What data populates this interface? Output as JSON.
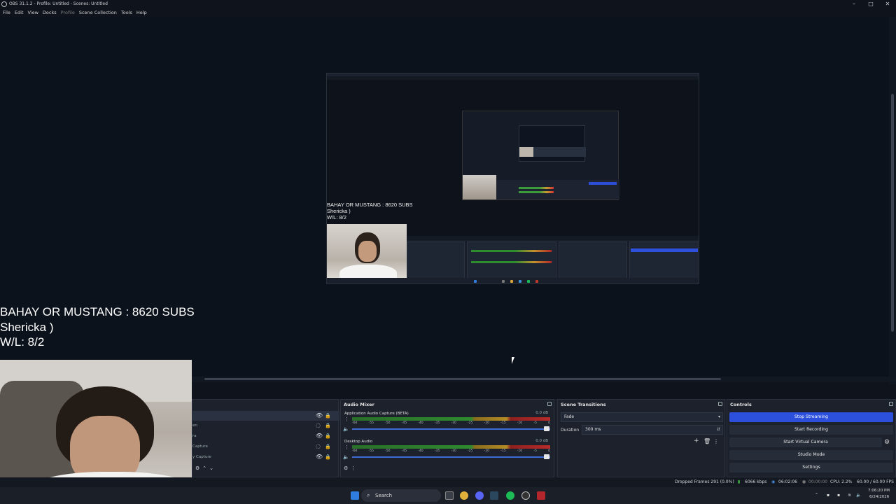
{
  "window": {
    "title": "OBS 31.1.2 - Profile: Untitled - Scenes: Untitled",
    "minimize": "–",
    "maximize": "□",
    "close": "✕"
  },
  "menu": {
    "items": [
      "File",
      "Edit",
      "View",
      "Docks",
      "Profile",
      "Scene Collection",
      "Tools",
      "Help"
    ]
  },
  "overlay": {
    "line1": "BAHAY OR MUSTANG : 8620 SUBS",
    "line2": "Shericka )",
    "line3": "W/L: 8/2"
  },
  "nested": {
    "line1": "BAHAY OR MUSTANG : 8620 SUBS",
    "line2": "Shericka )",
    "line3": "W/L: 8/2"
  },
  "sources": {
    "rows": [
      {
        "label": ""
      },
      {
        "label": "en"
      },
      {
        "label": "ra"
      },
      {
        "label": "Capture"
      },
      {
        "label": "y Capture"
      }
    ]
  },
  "audio_mixer": {
    "title": "Audio Mixer",
    "channels": [
      {
        "name": "Application Audio Capture (BETA)",
        "db": "0.0 dB"
      },
      {
        "name": "Desktop Audio",
        "db": "0.0 dB"
      }
    ],
    "ticks": [
      "-60",
      "-55",
      "-50",
      "-45",
      "-40",
      "-35",
      "-30",
      "-25",
      "-20",
      "-15",
      "-10",
      "-5",
      "0"
    ]
  },
  "scene_transitions": {
    "title": "Scene Transitions",
    "transition": "Fade",
    "duration_label": "Duration",
    "duration_value": "300 ms"
  },
  "controls": {
    "title": "Controls",
    "stop_streaming": "Stop Streaming",
    "start_recording": "Start Recording",
    "start_virtual_camera": "Start Virtual Camera",
    "studio_mode": "Studio Mode",
    "settings": "Settings"
  },
  "status": {
    "dropped": "Dropped Frames 291 (0.0%)",
    "kbps": "6066 kbps",
    "stream_time": "06:02:06",
    "rec_time": "00:00:00",
    "cpu": "CPU: 2.2%",
    "fps": "60.00 / 60.00 FPS"
  },
  "taskbar": {
    "search_placeholder": "Search",
    "time": "7:06:20 PM",
    "date": "6/24/2026"
  },
  "colors": {
    "accent": "#2c4fdc",
    "bg": "#0e131c",
    "dock": "#1c212c"
  }
}
